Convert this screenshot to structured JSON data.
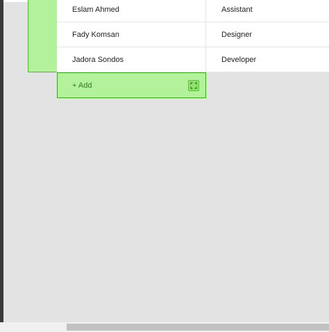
{
  "table": {
    "rows": [
      {
        "name": "Eslam Ahmed",
        "role": "Assistant"
      },
      {
        "name": "Fady Komsan",
        "role": "Designer"
      },
      {
        "name": "Jadora Sondos",
        "role": "Developer"
      }
    ]
  },
  "add_row": {
    "label": "+ Add",
    "expand_icon": "expand-icon"
  },
  "colors": {
    "accent_fill": "#b3f19a",
    "accent_border": "#39a81c",
    "accent_text": "#2f7d1c",
    "background": "#e3e3e3"
  }
}
